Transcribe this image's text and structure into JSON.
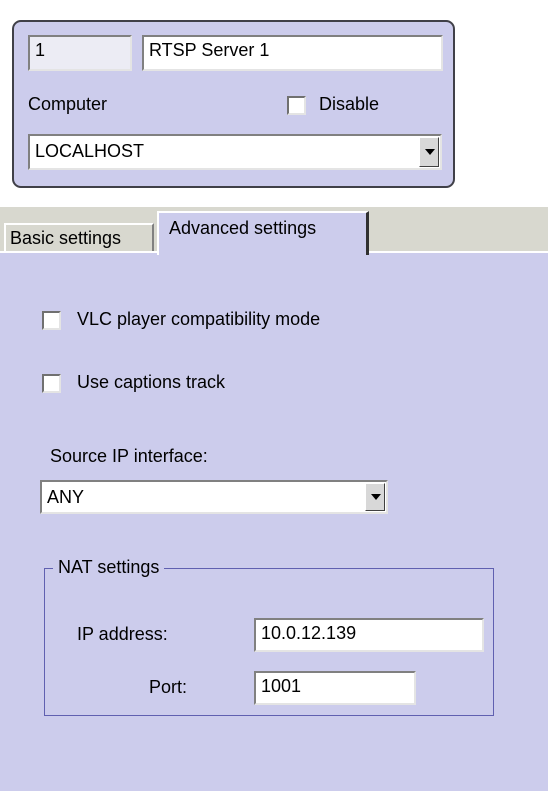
{
  "header": {
    "id_value": "1",
    "name_value": "RTSP Server 1",
    "computer_label": "Computer",
    "disable_label": "Disable",
    "computer_value": "LOCALHOST"
  },
  "tabs": [
    {
      "label": "Basic settings",
      "active": false
    },
    {
      "label": "Advanced settings",
      "active": true
    }
  ],
  "advanced": {
    "vlc_label": "VLC player compatibility mode",
    "vlc_checked": false,
    "captions_label": "Use captions track",
    "captions_checked": false,
    "source_ip_label": "Source IP interface:",
    "source_ip_value": "ANY",
    "nat": {
      "title": "NAT settings",
      "ip_label": "IP address:",
      "ip_value": "10.0.12.139",
      "port_label": "Port:",
      "port_value": "1001"
    }
  },
  "colors": {
    "panel_bg": "#ccccec",
    "tab_strip_bg": "#d8d8cf",
    "group_border": "#6060b0"
  }
}
